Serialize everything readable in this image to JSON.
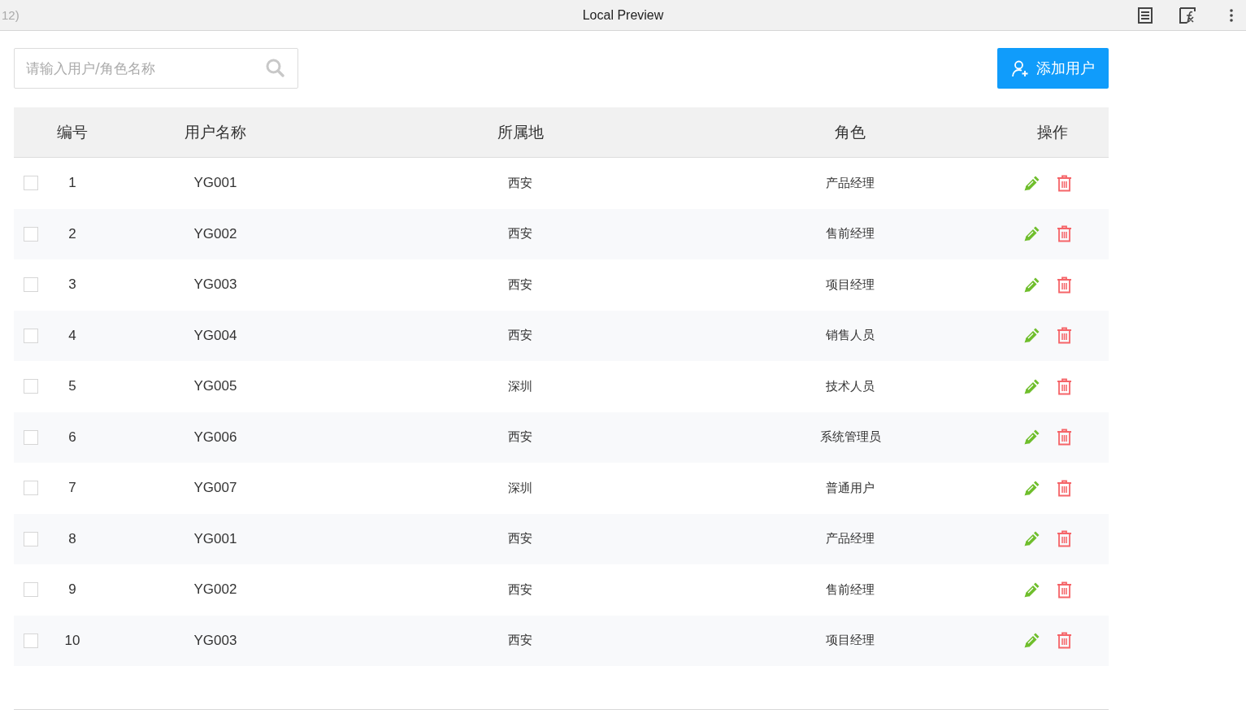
{
  "window": {
    "title": "Local Preview",
    "tab_fragment": "12)"
  },
  "search": {
    "placeholder": "请输入用户/角色名称"
  },
  "add_button": {
    "label": "添加用户"
  },
  "table": {
    "columns": [
      "编号",
      "用户名称",
      "所属地",
      "角色",
      "操作"
    ],
    "rows": [
      {
        "checked": false,
        "cells": [
          "1",
          "YG001",
          "西安",
          "产品经理"
        ]
      },
      {
        "checked": false,
        "cells": [
          "2",
          "YG002",
          "西安",
          "售前经理"
        ]
      },
      {
        "checked": false,
        "cells": [
          "3",
          "YG003",
          "西安",
          "项目经理"
        ]
      },
      {
        "checked": false,
        "cells": [
          "4",
          "YG004",
          "西安",
          "销售人员"
        ]
      },
      {
        "checked": false,
        "cells": [
          "5",
          "YG005",
          "深圳",
          "技术人员"
        ]
      },
      {
        "checked": false,
        "cells": [
          "6",
          "YG006",
          "西安",
          "系统管理员"
        ]
      },
      {
        "checked": false,
        "cells": [
          "7",
          "YG007",
          "深圳",
          "普通用户"
        ]
      },
      {
        "checked": false,
        "cells": [
          "8",
          "YG001",
          "西安",
          "产品经理"
        ]
      },
      {
        "checked": false,
        "cells": [
          "9",
          "YG002",
          "西安",
          "售前经理"
        ]
      },
      {
        "checked": false,
        "cells": [
          "10",
          "YG003",
          "西安",
          "项目经理"
        ]
      }
    ]
  }
}
